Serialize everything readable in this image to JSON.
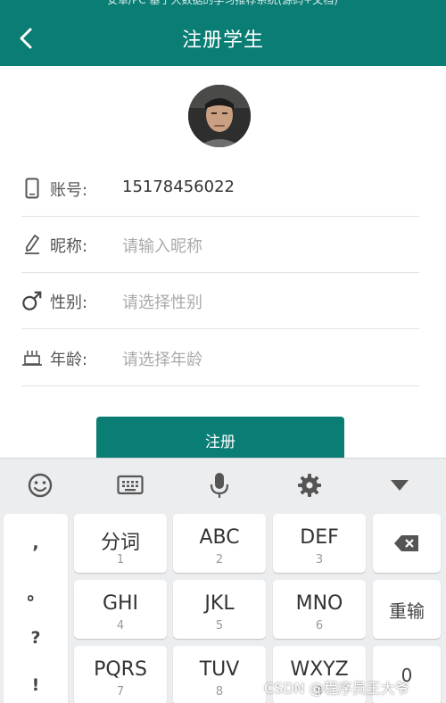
{
  "status_bar": {
    "text": "安卓/PC 基于大数据的学习推荐系统(源码+文档)"
  },
  "header": {
    "title": "注册学生"
  },
  "form": {
    "account": {
      "label": "账号:",
      "value": "15178456022"
    },
    "nickname": {
      "label": "昵称:",
      "placeholder": "请输入昵称"
    },
    "gender": {
      "label": "性别:",
      "placeholder": "请选择性别"
    },
    "age": {
      "label": "年龄:",
      "placeholder": "请选择年龄"
    }
  },
  "register_button": {
    "label": "注册"
  },
  "keyboard": {
    "toolbar": [
      "emoji-icon",
      "keyboard-icon",
      "microphone-icon",
      "gear-icon",
      "collapse-icon"
    ],
    "punctuation": [
      ",",
      "。",
      "?",
      "!"
    ],
    "keys": [
      {
        "main": "分词",
        "sub": "1"
      },
      {
        "main": "ABC",
        "sub": "2"
      },
      {
        "main": "DEF",
        "sub": "3"
      },
      {
        "main": "GHI",
        "sub": "4"
      },
      {
        "main": "JKL",
        "sub": "5"
      },
      {
        "main": "MNO",
        "sub": "6"
      },
      {
        "main": "PQRS",
        "sub": "7"
      },
      {
        "main": "TUV",
        "sub": "8"
      },
      {
        "main": "WXYZ",
        "sub": "9"
      }
    ],
    "side_keys": {
      "backspace": "backspace-icon",
      "reenter": "重输",
      "zero": "0"
    }
  },
  "watermark": "CSDN @程序员王大爷",
  "colors": {
    "primary": "#0a7d74",
    "keyboard_bg": "#ecedef"
  }
}
